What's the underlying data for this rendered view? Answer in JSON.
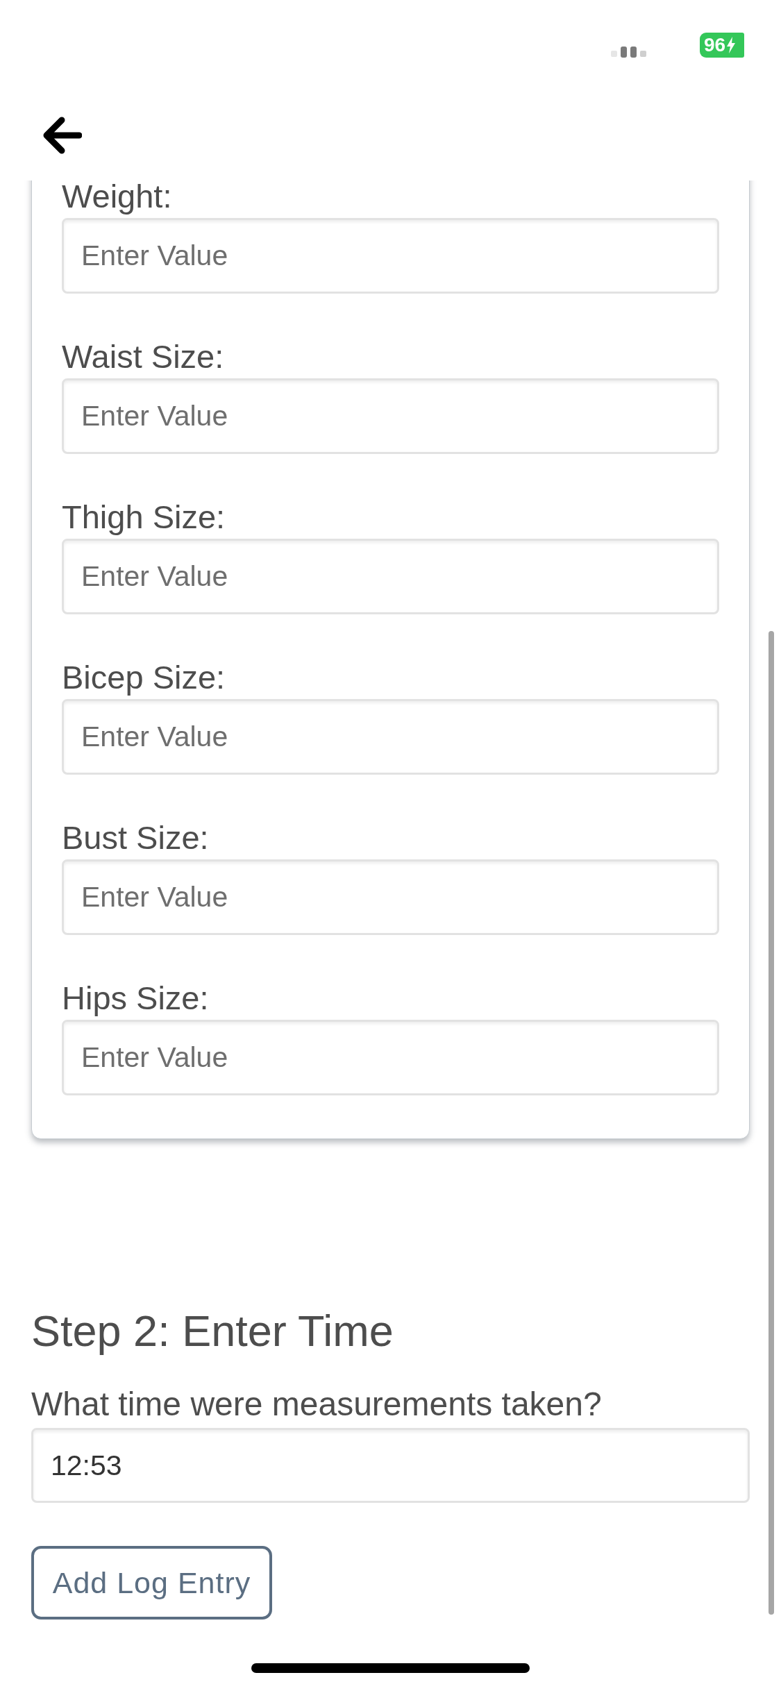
{
  "status_bar": {
    "battery": "96",
    "charging": true
  },
  "measurements": {
    "fields": [
      {
        "label": "Weight:",
        "placeholder": "Enter Value"
      },
      {
        "label": "Waist Size:",
        "placeholder": "Enter Value"
      },
      {
        "label": "Thigh Size:",
        "placeholder": "Enter Value"
      },
      {
        "label": "Bicep Size:",
        "placeholder": "Enter Value"
      },
      {
        "label": "Bust Size:",
        "placeholder": "Enter Value"
      },
      {
        "label": "Hips Size:",
        "placeholder": "Enter Value"
      }
    ]
  },
  "step_2": {
    "heading": "Step 2: Enter Time",
    "question": "What time were measurements taken?",
    "time_value": "12:53"
  },
  "add_button": "Add Log Entry"
}
